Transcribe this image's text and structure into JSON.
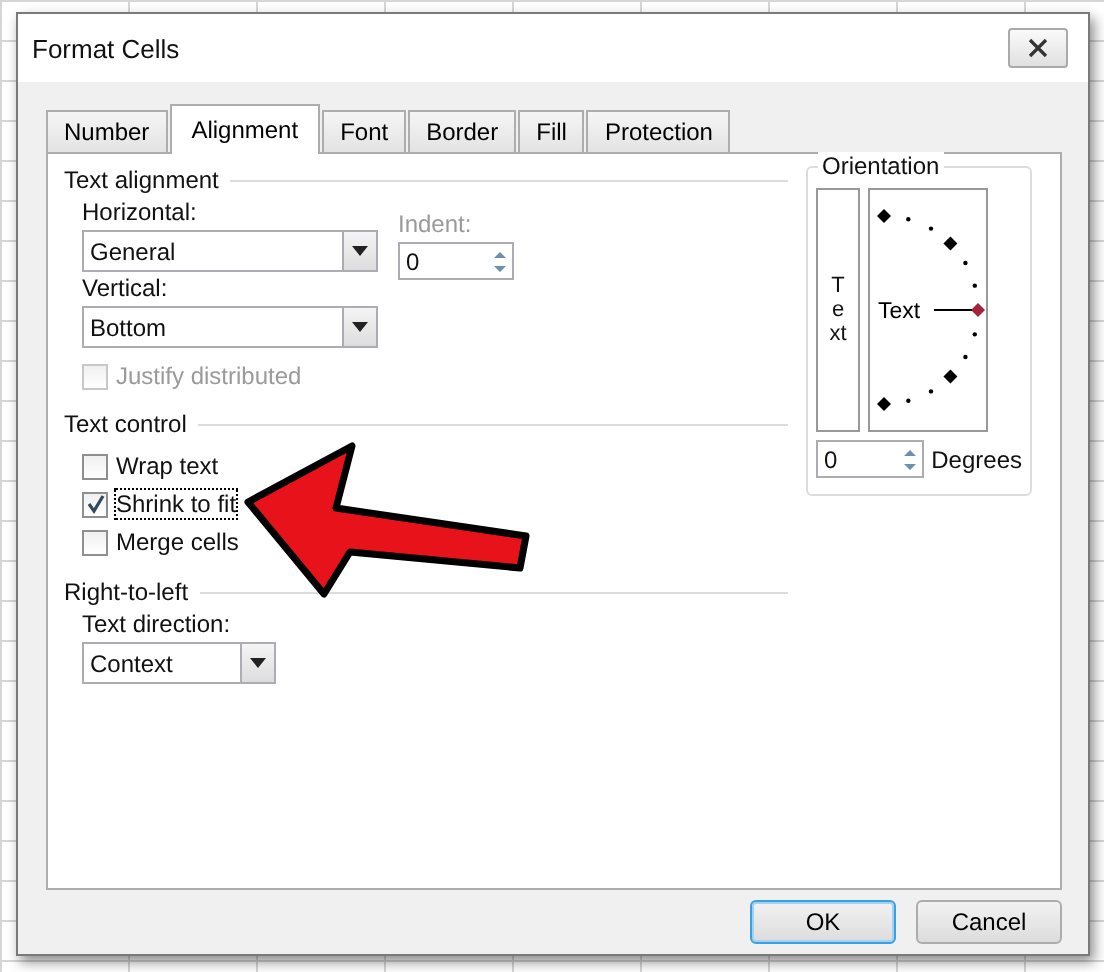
{
  "window": {
    "title": "Format Cells"
  },
  "tabs": [
    {
      "label": "Number",
      "selected": false
    },
    {
      "label": "Alignment",
      "selected": true
    },
    {
      "label": "Font",
      "selected": false
    },
    {
      "label": "Border",
      "selected": false
    },
    {
      "label": "Fill",
      "selected": false
    },
    {
      "label": "Protection",
      "selected": false
    }
  ],
  "text_alignment": {
    "heading": "Text alignment",
    "horizontal": {
      "label": "Horizontal:",
      "value": "General"
    },
    "indent": {
      "label": "Indent:",
      "value": "0",
      "disabled": true
    },
    "vertical": {
      "label": "Vertical:",
      "value": "Bottom"
    },
    "justify_distributed": {
      "label": "Justify distributed",
      "checked": false,
      "disabled": true
    }
  },
  "text_control": {
    "heading": "Text control",
    "options": [
      {
        "label": "Wrap text",
        "checked": false,
        "focused": false
      },
      {
        "label": "Shrink to fit",
        "checked": true,
        "focused": true
      },
      {
        "label": "Merge cells",
        "checked": false,
        "focused": false
      }
    ]
  },
  "right_to_left": {
    "heading": "Right-to-left",
    "text_direction": {
      "label": "Text direction:",
      "value": "Context"
    }
  },
  "orientation": {
    "heading": "Orientation",
    "vertical_text": "Text",
    "dial_text": "Text",
    "degrees": {
      "value": "0",
      "label": "Degrees"
    }
  },
  "buttons": [
    {
      "label": "OK",
      "default": true
    },
    {
      "label": "Cancel",
      "default": false
    }
  ]
}
